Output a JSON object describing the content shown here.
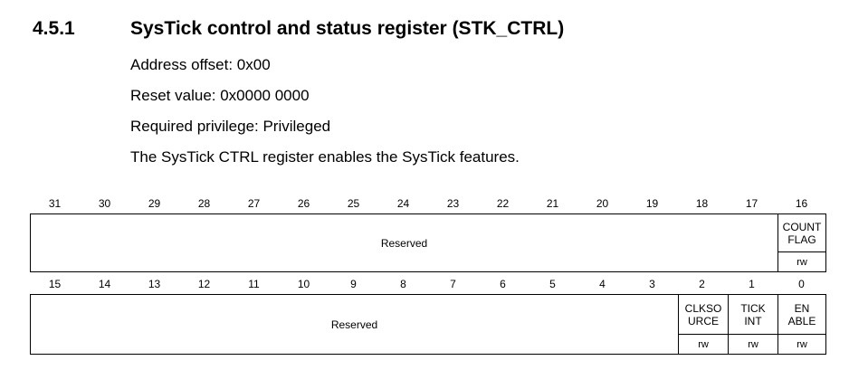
{
  "section": {
    "number": "4.5.1",
    "title": "SysTick control and status register (STK_CTRL)"
  },
  "paragraphs": [
    "Address offset: 0x00",
    "Reset value: 0x0000 0000",
    "Required privilege: Privileged",
    "The SysTick CTRL register enables the SysTick features."
  ],
  "upper_register": {
    "bit_numbers": [
      "31",
      "30",
      "29",
      "28",
      "27",
      "26",
      "25",
      "24",
      "23",
      "22",
      "21",
      "20",
      "19",
      "18",
      "17",
      "16"
    ],
    "reserved_label": "Reserved",
    "fields": [
      {
        "name": "COUNT\nFLAG",
        "access": "rw"
      }
    ]
  },
  "lower_register": {
    "bit_numbers": [
      "15",
      "14",
      "13",
      "12",
      "11",
      "10",
      "9",
      "8",
      "7",
      "6",
      "5",
      "4",
      "3",
      "2",
      "1",
      "0"
    ],
    "reserved_label": "Reserved",
    "fields": [
      {
        "name": "CLKSO\nURCE",
        "access": "rw"
      },
      {
        "name": "TICK\nINT",
        "access": "rw"
      },
      {
        "name": "EN\nABLE",
        "access": "rw"
      }
    ]
  }
}
